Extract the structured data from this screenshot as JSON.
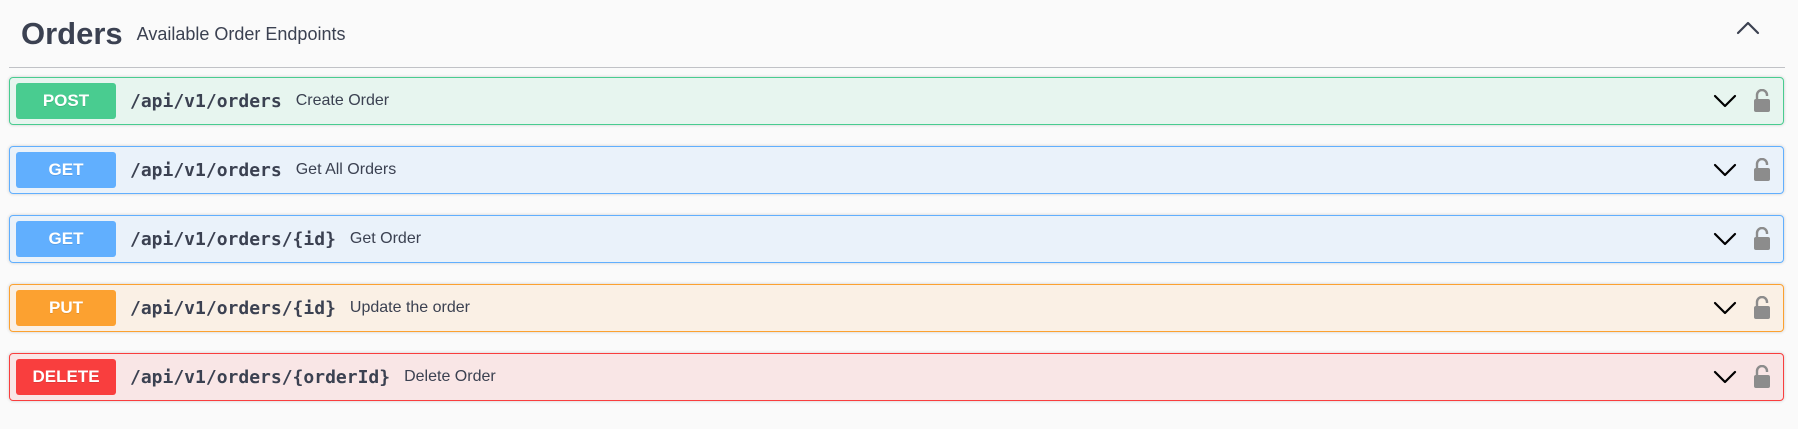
{
  "tag": {
    "title": "Orders",
    "description": "Available Order Endpoints",
    "toggle_icon": "chevron-up-icon"
  },
  "operations": [
    {
      "method": "POST",
      "path": "/api/v1/orders",
      "summary": "Create Order",
      "color": "#49cc90"
    },
    {
      "method": "GET",
      "path": "/api/v1/orders",
      "summary": "Get All Orders",
      "color": "#61affe"
    },
    {
      "method": "GET",
      "path": "/api/v1/orders/{id}",
      "summary": "Get Order",
      "color": "#61affe"
    },
    {
      "method": "PUT",
      "path": "/api/v1/orders/{id}",
      "summary": "Update the order",
      "color": "#fca130"
    },
    {
      "method": "DELETE",
      "path": "/api/v1/orders/{orderId}",
      "summary": "Delete Order",
      "color": "#f93e3e"
    }
  ],
  "icons": {
    "expand": "chevron-down-icon",
    "auth": "unlocked-lock-icon"
  }
}
